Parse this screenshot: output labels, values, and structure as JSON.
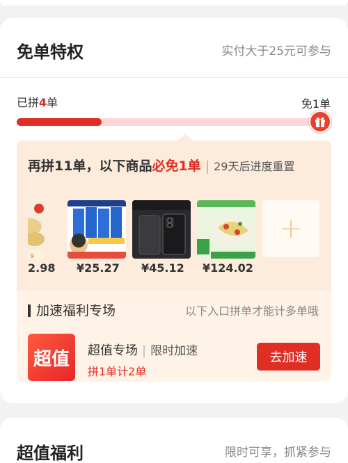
{
  "privilege": {
    "title": "免单特权",
    "condition": "实付大于25元可参与",
    "progress_prefix": "已拼",
    "progress_count": "4",
    "progress_suffix": "单",
    "goal_label": "免1单",
    "progress_fraction": 0.286
  },
  "offer": {
    "lead": "再拼11单，以下商品",
    "highlight": "必免1单",
    "reset_note": "29天后进度重置",
    "prices": [
      "2.98",
      "¥25.27",
      "¥45.12",
      "¥124.02"
    ],
    "add_symbol": "+"
  },
  "boost": {
    "title": "加速福利专场",
    "note": "以下入口拼单才能计多单哦",
    "badge_text": "超值",
    "name": "超值专场",
    "tag": "限时加速",
    "rule": "拼1单计2单",
    "button": "去加速"
  },
  "section2": {
    "title": "超值福利",
    "note": "限时可享，抓紧参与"
  },
  "colors": {
    "accent": "#e02e24",
    "panel": "#fdebdc",
    "track": "#fbd7da"
  },
  "icons": [
    "gift-icon",
    "plus-icon"
  ]
}
